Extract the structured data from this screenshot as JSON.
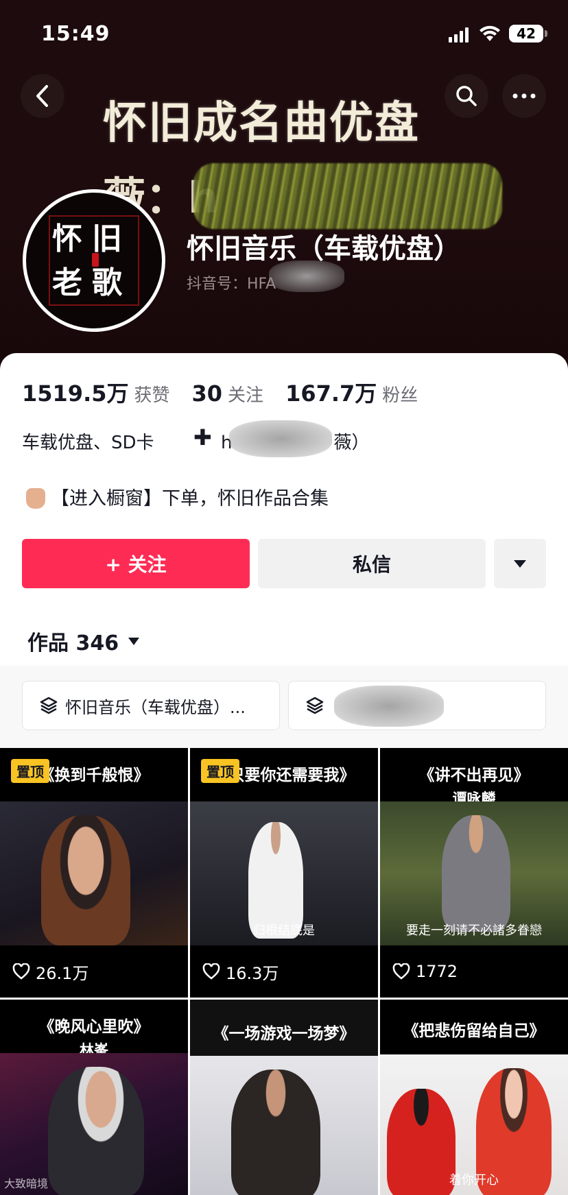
{
  "status_bar": {
    "time": "15:49",
    "battery": "42"
  },
  "banner": {
    "title": "怀旧成名曲优盘",
    "subtitle": "薇：h"
  },
  "avatar": {
    "text": "怀旧老歌"
  },
  "profile": {
    "name": "怀旧音乐（车载优盘）",
    "id": "抖音号：HFA"
  },
  "stats": [
    {
      "value": "1519.5万",
      "label": "获赞"
    },
    {
      "value": "30",
      "label": "关注"
    },
    {
      "value": "167.7万",
      "label": "粉丝"
    }
  ],
  "bio": {
    "line1": "车载优盘、SD卡",
    "plus": "✚",
    "contact_prefix": "h",
    "contact_suffix": "薇）",
    "line2": "【进入橱窗】下单，怀旧作品合集"
  },
  "actions": {
    "follow": "+ 关注",
    "message": "私信"
  },
  "works_tab": {
    "label": "作品 346"
  },
  "collections": [
    {
      "label": "怀旧音乐（车载优盘）..."
    },
    {
      "label": ""
    }
  ],
  "videos": [
    {
      "title": "《换到千般恨》",
      "title2": "",
      "pinned": "置顶",
      "likes": "26.1万",
      "subtitle": ""
    },
    {
      "title": "《只要你还需要我》",
      "title2": "",
      "pinned": "置顶",
      "likes": "16.3万",
      "subtitle": "归根结底是"
    },
    {
      "title": "《讲不出再见》",
      "title2": "谭咏麟",
      "pinned": "",
      "likes": "1772",
      "subtitle": "要走一刻请不必諸多眷戀"
    },
    {
      "title": "《晚风心里吹》",
      "title2": "林峯",
      "pinned": "",
      "likes": "",
      "subtitle": ""
    },
    {
      "title": "《一场游戏一场梦》",
      "title2": "",
      "pinned": "",
      "likes": "",
      "subtitle": ""
    },
    {
      "title": "《把悲伤留给自己》",
      "title2": "",
      "pinned": "",
      "likes": "",
      "subtitle": "着你开心"
    }
  ],
  "watermark": "大致暗境",
  "colors": {
    "accent": "#fe2c55",
    "pin": "#f9c423",
    "banner_bg": "#1d0b0d"
  }
}
